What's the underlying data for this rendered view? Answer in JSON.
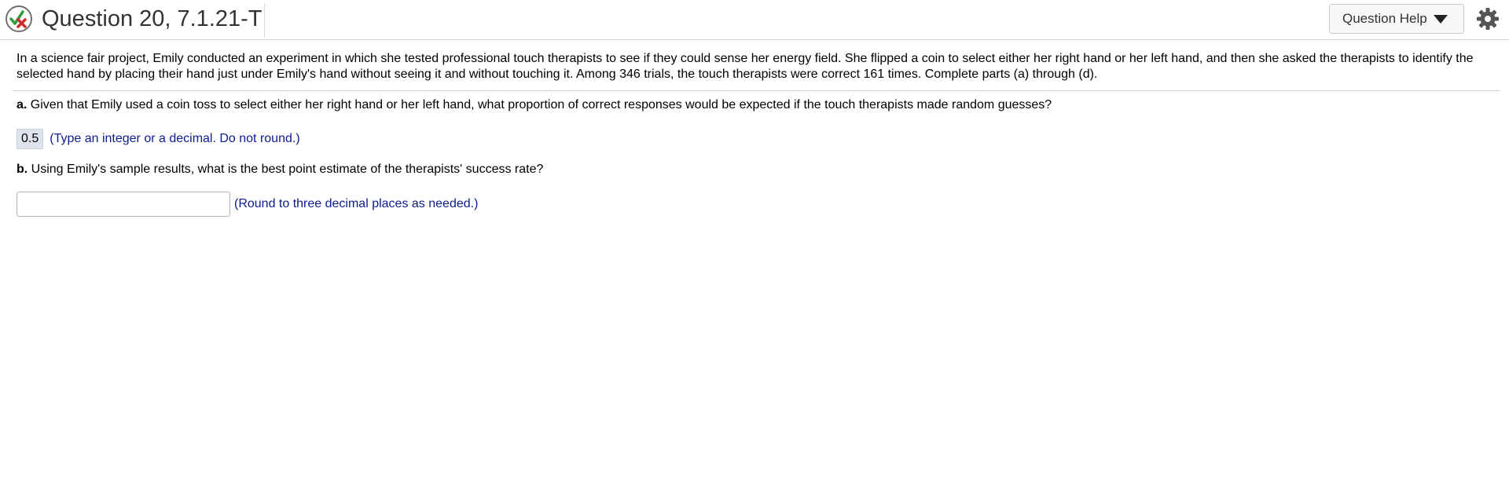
{
  "header": {
    "title": "Question 20, 7.1.21-T",
    "help_label": "Question Help",
    "status_icon": "partial-correct-icon",
    "settings_icon": "gear-icon"
  },
  "question": {
    "intro": "In a science fair project, Emily conducted an experiment in which she tested professional touch therapists to see if they could sense her energy field. She flipped a coin to select either her right hand or her left hand, and then she asked the therapists to identify the selected hand by placing their hand just under Emily's hand without seeing it and without touching it. Among 346 trials, the touch therapists were correct 161 times. Complete parts (a) through (d).",
    "part_a": {
      "label": "a.",
      "text": " Given that Emily used a coin toss to select either her right hand or her left hand, what proportion of correct responses would be expected if the touch therapists made random guesses?",
      "answer": "0.5",
      "hint": "(Type an integer or a decimal. Do not round.)"
    },
    "part_b": {
      "label": "b.",
      "text": " Using Emily's sample results, what is the best point estimate of the therapists' success rate?",
      "answer": "",
      "hint": "(Round to three decimal places as needed.)"
    }
  },
  "colors": {
    "hint": "#0b1c8c",
    "answer_bg": "#dde4ee",
    "check_green": "#2e9e3b",
    "cross_red": "#d12a2a"
  }
}
